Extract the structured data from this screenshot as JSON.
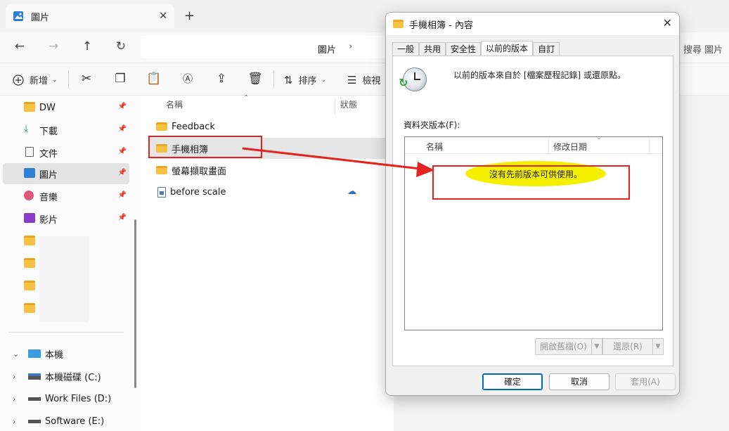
{
  "explorer": {
    "tab_title": "圖片",
    "tab_close": "✕",
    "new_tab": "+",
    "address_path": "圖片",
    "address_chevron": "›",
    "search_placeholder": "搜尋 圖片",
    "toolbar": {
      "new_label": "新增",
      "sort_label": "排序",
      "view_label": "檢視"
    },
    "sidebar": {
      "items": [
        {
          "label": "DW",
          "icon": "folder-icon"
        },
        {
          "label": "下載",
          "icon": "download-icon"
        },
        {
          "label": "文件",
          "icon": "document-icon"
        },
        {
          "label": "圖片",
          "icon": "pictures-icon"
        },
        {
          "label": "音樂",
          "icon": "music-icon"
        },
        {
          "label": "影片",
          "icon": "video-icon"
        }
      ],
      "tree": [
        {
          "label": "本機",
          "icon": "computer-icon"
        },
        {
          "label": "本機磁碟 (C:)",
          "icon": "system-drive-icon"
        },
        {
          "label": "Work Files (D:)",
          "icon": "drive-icon"
        },
        {
          "label": "Software (E:)",
          "icon": "drive-icon"
        }
      ]
    },
    "file_list": {
      "columns": [
        "名稱",
        "狀態"
      ],
      "rows": [
        {
          "name": "Feedback",
          "type": "folder"
        },
        {
          "name": "手機相簿",
          "type": "folder"
        },
        {
          "name": "螢幕擷取畫面",
          "type": "folder"
        },
        {
          "name": "before scale",
          "type": "file"
        }
      ]
    }
  },
  "dialog": {
    "title": "手機相簿 - 內容",
    "close": "✕",
    "tabs": [
      "一般",
      "共用",
      "安全性",
      "以前的版本",
      "自訂"
    ],
    "active_tab": "以前的版本",
    "info_text": "以前的版本來自於 [檔案歷程記錄] 或還原點。",
    "versions_label": "資料夾版本(F):",
    "list_columns": [
      "名稱",
      "修改日期"
    ],
    "empty_message": "沒有先前版本可供使用。",
    "open_button": "開啟舊檔(O)",
    "restore_button": "還原(R)",
    "ok_button": "確定",
    "cancel_button": "取消",
    "apply_button": "套用(A)"
  },
  "colors": {
    "annotation_red": "#e5221e",
    "highlight_yellow": "#f5ef00",
    "folder_yellow": "#f6c042",
    "accent_blue": "#0067c0"
  }
}
